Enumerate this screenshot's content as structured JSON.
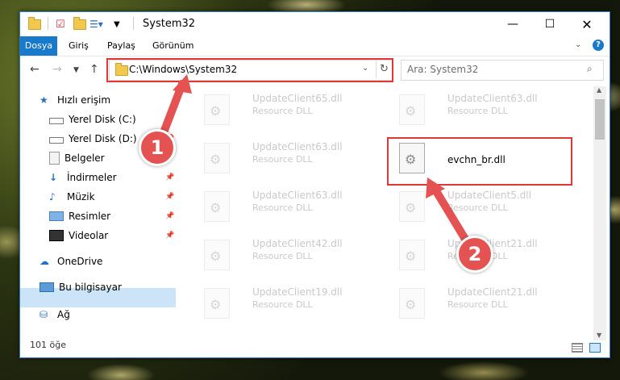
{
  "title": "System32",
  "ribbon": {
    "tabs": [
      "Dosya",
      "Giriş",
      "Paylaş",
      "Görünüm"
    ]
  },
  "address": {
    "path": "C:\\Windows\\System32"
  },
  "search": {
    "placeholder": "Ara: System32"
  },
  "sidebar": {
    "items": [
      {
        "label": "Hızlı erişim",
        "icon": "star-icon"
      },
      {
        "label": "Yerel Disk (C:)",
        "icon": "drive-icon",
        "pinned": true
      },
      {
        "label": "Yerel Disk (D:)",
        "icon": "drive-icon",
        "pinned": true
      },
      {
        "label": "Belgeler",
        "icon": "documents-icon",
        "pinned": true
      },
      {
        "label": "İndirmeler",
        "icon": "download-icon",
        "pinned": true
      },
      {
        "label": "Müzik",
        "icon": "music-icon",
        "pinned": true
      },
      {
        "label": "Resimler",
        "icon": "pictures-icon",
        "pinned": true
      },
      {
        "label": "Videolar",
        "icon": "video-icon",
        "pinned": true
      },
      {
        "label": "OneDrive",
        "icon": "cloud-icon"
      },
      {
        "label": "Bu bilgisayar",
        "icon": "computer-icon",
        "selected": true
      },
      {
        "label": "Ağ",
        "icon": "network-icon"
      }
    ]
  },
  "files": [
    {
      "name": "UpdateClient65.dll",
      "type": "Resource DLL",
      "faded": true
    },
    {
      "name": "UpdateClient63.dll",
      "type": "Resource DLL",
      "faded": true
    },
    {
      "name": "UpdateClient63.dll",
      "type": "Resource DLL",
      "faded": true
    },
    {
      "name": "evchn_br.dll",
      "type": "",
      "faded": false
    },
    {
      "name": "UpdateClient63.dll",
      "type": "Resource DLL",
      "faded": true
    },
    {
      "name": "UpdateClient5.dll",
      "type": "Resource DLL",
      "faded": true
    },
    {
      "name": "UpdateClient42.dll",
      "type": "Resource DLL",
      "faded": true
    },
    {
      "name": "UpdateClient21.dll",
      "type": "Resource DLL",
      "faded": true
    },
    {
      "name": "UpdateClient19.dll",
      "type": "Resource DLL",
      "faded": true
    },
    {
      "name": "UpdateClient21.dll",
      "type": "Resource DLL",
      "faded": true
    }
  ],
  "status": {
    "count": "101 öğe"
  },
  "annotations": {
    "step1": "1",
    "step2": "2"
  },
  "colors": {
    "accent": "#1979ca",
    "highlight": "#e03838",
    "selected": "#cce4f7"
  }
}
